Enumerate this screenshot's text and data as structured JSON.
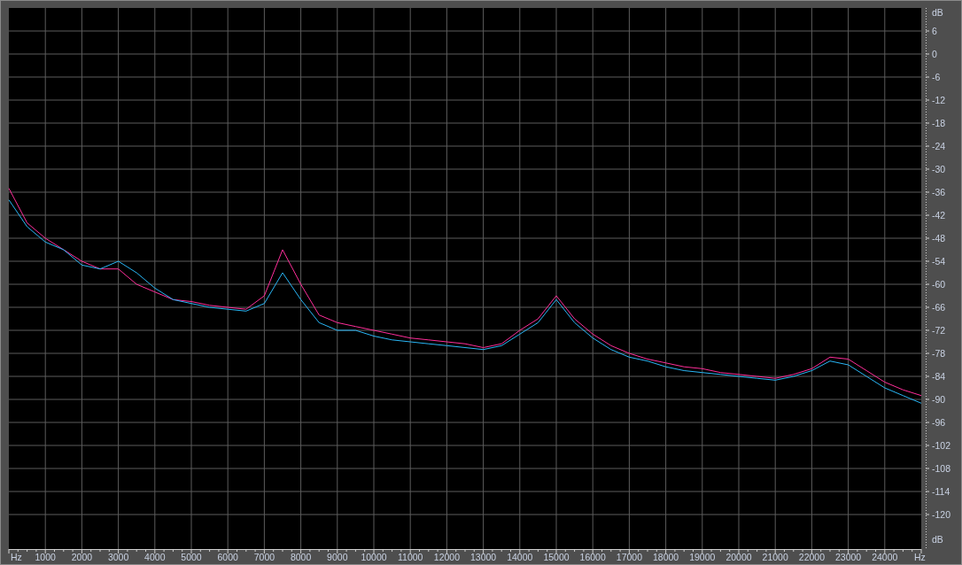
{
  "chart_data": {
    "type": "line",
    "grid": true,
    "xlabel": "Hz",
    "ylabel": "dB",
    "xlim": [
      0,
      25000
    ],
    "ylim": [
      -129,
      12
    ],
    "x": [
      0,
      500,
      1000,
      1500,
      2000,
      2500,
      3000,
      3500,
      4000,
      4500,
      5000,
      5500,
      6000,
      6500,
      7000,
      7500,
      8000,
      8500,
      9000,
      9500,
      10000,
      10500,
      11000,
      11500,
      12000,
      12500,
      13000,
      13500,
      14000,
      14500,
      15000,
      15500,
      16000,
      16500,
      17000,
      17500,
      18000,
      18500,
      19000,
      19500,
      20000,
      20500,
      21000,
      21500,
      22000,
      22500,
      23000,
      23500,
      24000,
      24500,
      25000
    ],
    "series": [
      {
        "color": "#ff2e9a",
        "values": [
          -35,
          -44,
          -48,
          -51,
          -54,
          -56,
          -56,
          -60,
          -62,
          -64,
          -64.5,
          -65.5,
          -66,
          -66.5,
          -63,
          -51,
          -60,
          -68,
          -70,
          -71,
          -72,
          -73,
          -74,
          -74.5,
          -75,
          -75.5,
          -76.5,
          -75.5,
          -72,
          -69,
          -63,
          -69,
          -73,
          -76,
          -78,
          -79.5,
          -80.5,
          -81.5,
          -82,
          -83,
          -83.5,
          -84,
          -84.5,
          -83.5,
          -82,
          -79,
          -79.5,
          -82.5,
          -85.5,
          -87.5,
          -89
        ]
      },
      {
        "color": "#29b6f6",
        "values": [
          -38,
          -45,
          -49,
          -51,
          -55,
          -56,
          -54,
          -57,
          -61,
          -64,
          -65,
          -66,
          -66.5,
          -67,
          -65,
          -57,
          -64,
          -70,
          -72,
          -72,
          -73.5,
          -74.5,
          -75,
          -75.5,
          -76,
          -76.5,
          -77,
          -76,
          -73,
          -70,
          -64,
          -70,
          -74,
          -77,
          -79,
          -80,
          -81.5,
          -82.5,
          -83,
          -83.5,
          -84,
          -84.5,
          -85,
          -84,
          -82.5,
          -80,
          -81,
          -84,
          -87,
          -89,
          -91
        ]
      }
    ],
    "xticks": [
      1000,
      2000,
      3000,
      4000,
      5000,
      6000,
      7000,
      8000,
      9000,
      10000,
      11000,
      12000,
      13000,
      14000,
      15000,
      16000,
      17000,
      18000,
      19000,
      20000,
      21000,
      22000,
      23000,
      24000
    ],
    "yticks": [
      6,
      0,
      -6,
      -12,
      -18,
      -24,
      -30,
      -36,
      -42,
      -48,
      -54,
      -60,
      -66,
      -72,
      -78,
      -84,
      -90,
      -96,
      -102,
      -108,
      -114,
      -120
    ]
  }
}
